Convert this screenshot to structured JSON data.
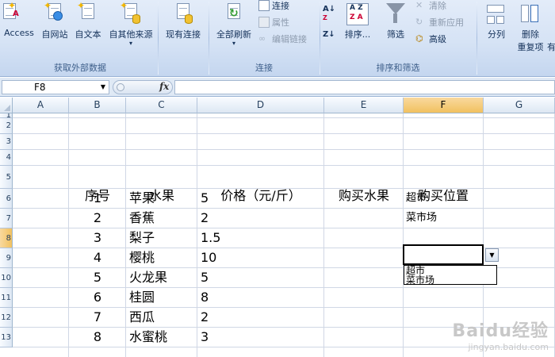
{
  "ribbon": {
    "get_external": {
      "title": "获取外部数据",
      "buttons": [
        {
          "label": "Access",
          "icon": "access-icon"
        },
        {
          "label": "自网站",
          "icon": "web-icon"
        },
        {
          "label": "自文本",
          "icon": "text-file-icon"
        },
        {
          "label": "自其他来源",
          "icon": "other-sources-icon"
        },
        {
          "label": "现有连接",
          "icon": "existing-connections-icon"
        }
      ]
    },
    "connections": {
      "title": "连接",
      "refresh_label": "全部刷新",
      "small": [
        {
          "label": "连接",
          "icon": "connections-icon",
          "enabled": true
        },
        {
          "label": "属性",
          "icon": "properties-icon",
          "enabled": false
        },
        {
          "label": "编辑链接",
          "icon": "edit-links-icon",
          "enabled": false
        }
      ]
    },
    "sort_filter": {
      "title": "排序和筛选",
      "sort_label": "排序...",
      "filter_label": "筛选",
      "small": [
        {
          "label": "清除",
          "icon": "clear-filter-icon",
          "enabled": false
        },
        {
          "label": "重新应用",
          "icon": "reapply-icon",
          "enabled": false
        },
        {
          "label": "高级",
          "icon": "advanced-filter-icon",
          "enabled": true
        }
      ]
    },
    "data_tools": {
      "split_label": "分列",
      "remove_label": "删除",
      "remove_sub_label": "重复项",
      "extra_label": "有"
    }
  },
  "formula_bar": {
    "name_box": "F8",
    "fx": "fx",
    "formula": ""
  },
  "columns": [
    "A",
    "B",
    "C",
    "D",
    "E",
    "F",
    "G"
  ],
  "selected_column": "F",
  "rows": [
    "1",
    "2",
    "3",
    "4",
    "5",
    "6",
    "7",
    "8",
    "9",
    "10",
    "11",
    "12",
    "13"
  ],
  "selected_row": "8",
  "headers": {
    "seq": "序号",
    "fruit": "水果",
    "price": "价格（元/斤）",
    "buy_fruit": "购买水果",
    "buy_place": "购买位置"
  },
  "table": [
    {
      "seq": "1",
      "fruit": "苹果",
      "price": "5",
      "place": "超市"
    },
    {
      "seq": "2",
      "fruit": "香蕉",
      "price": "2",
      "place": "菜市场"
    },
    {
      "seq": "3",
      "fruit": "梨子",
      "price": "1.5",
      "place": ""
    },
    {
      "seq": "4",
      "fruit": "樱桃",
      "price": "10",
      "place": ""
    },
    {
      "seq": "5",
      "fruit": "火龙果",
      "price": "5",
      "place": ""
    },
    {
      "seq": "6",
      "fruit": "桂圆",
      "price": "8",
      "place": ""
    },
    {
      "seq": "7",
      "fruit": "西瓜",
      "price": "2",
      "place": ""
    },
    {
      "seq": "8",
      "fruit": "水蜜桃",
      "price": "3",
      "place": ""
    }
  ],
  "dropdown": {
    "options": [
      "超市",
      "菜市场"
    ]
  },
  "watermark": {
    "main": "Baidu经验",
    "sub": "jingyan.baidu.com"
  },
  "colors": {
    "ribbon_bg": "#d6e3f5",
    "selected_header": "#f1c15f",
    "gridline": "#d0d7e5"
  }
}
